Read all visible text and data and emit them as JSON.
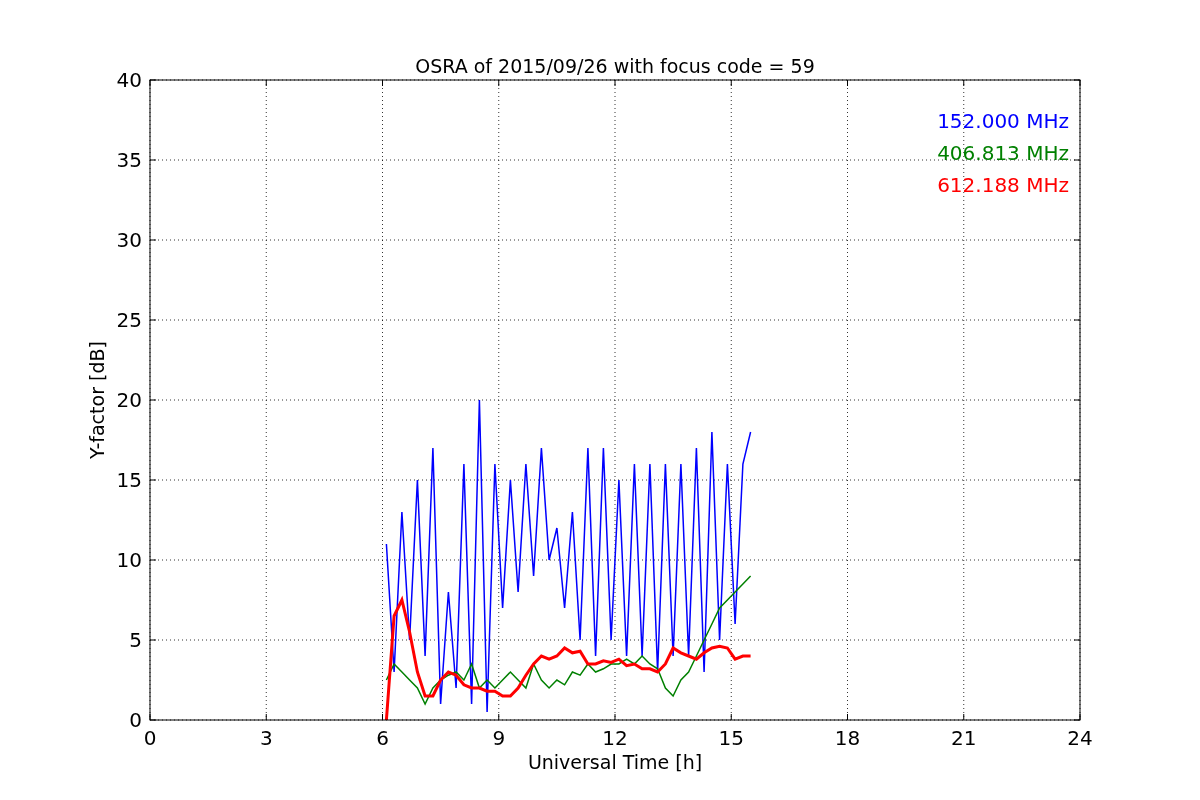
{
  "chart_data": {
    "type": "line",
    "title": "OSRA of 2015/09/26 with focus code = 59",
    "xlabel": "Universal Time [h]",
    "ylabel": "Y-factor [dB]",
    "x": [
      6.1,
      6.3,
      6.5,
      6.7,
      6.9,
      7.1,
      7.3,
      7.5,
      7.7,
      7.9,
      8.1,
      8.3,
      8.5,
      8.7,
      8.9,
      9.1,
      9.3,
      9.5,
      9.7,
      9.9,
      10.1,
      10.3,
      10.5,
      10.7,
      10.9,
      11.1,
      11.3,
      11.5,
      11.7,
      11.9,
      12.1,
      12.3,
      12.5,
      12.7,
      12.9,
      13.1,
      13.3,
      13.5,
      13.7,
      13.9,
      14.1,
      14.3,
      14.5,
      14.7,
      14.9,
      15.1,
      15.3,
      15.5
    ],
    "series": [
      {
        "name": "152.000 MHz",
        "color": "#0000ff",
        "values": [
          11,
          3,
          13,
          5,
          15,
          4,
          17,
          1,
          8,
          2,
          16,
          1,
          20,
          0.5,
          16,
          7,
          15,
          8,
          16,
          9,
          17,
          10,
          12,
          7,
          13,
          5,
          17,
          4,
          17,
          5,
          15,
          4,
          16,
          4,
          16,
          3,
          16,
          4,
          16,
          4,
          17,
          3,
          18,
          5,
          16,
          6,
          16,
          18
        ]
      },
      {
        "name": "406.813 MHz",
        "color": "#008000",
        "values": [
          2.5,
          3.5,
          3,
          2.5,
          2,
          1,
          2,
          2.5,
          2.8,
          3,
          2.5,
          3.5,
          2,
          2.5,
          2,
          2.5,
          3,
          2.5,
          2,
          3.5,
          2.5,
          2,
          2.5,
          2.2,
          3,
          2.8,
          3.5,
          3,
          3.2,
          3.5,
          3.5,
          3.8,
          3.5,
          4,
          3.5,
          3.2,
          2,
          1.5,
          2.5,
          3,
          4,
          5,
          6,
          7,
          7.5,
          8,
          8.5,
          9
        ]
      },
      {
        "name": "612.188 MHz",
        "color": "#ff0000",
        "values": [
          0,
          6.5,
          7.5,
          5.5,
          3,
          1.5,
          1.5,
          2.5,
          3,
          2.8,
          2.2,
          2,
          2,
          1.8,
          1.8,
          1.5,
          1.5,
          2,
          2.8,
          3.5,
          4,
          3.8,
          4,
          4.5,
          4.2,
          4.3,
          3.5,
          3.5,
          3.7,
          3.6,
          3.8,
          3.4,
          3.5,
          3.2,
          3.2,
          3,
          3.5,
          4.5,
          4.2,
          4,
          3.8,
          4.2,
          4.5,
          4.6,
          4.5,
          3.8,
          4,
          4
        ]
      }
    ],
    "grid": true,
    "xlim": [
      0,
      24
    ],
    "ylim": [
      0,
      40
    ],
    "xticks": [
      0,
      3,
      6,
      9,
      12,
      15,
      18,
      21,
      24
    ],
    "yticks": [
      0,
      5,
      10,
      15,
      20,
      25,
      30,
      35,
      40
    ]
  }
}
